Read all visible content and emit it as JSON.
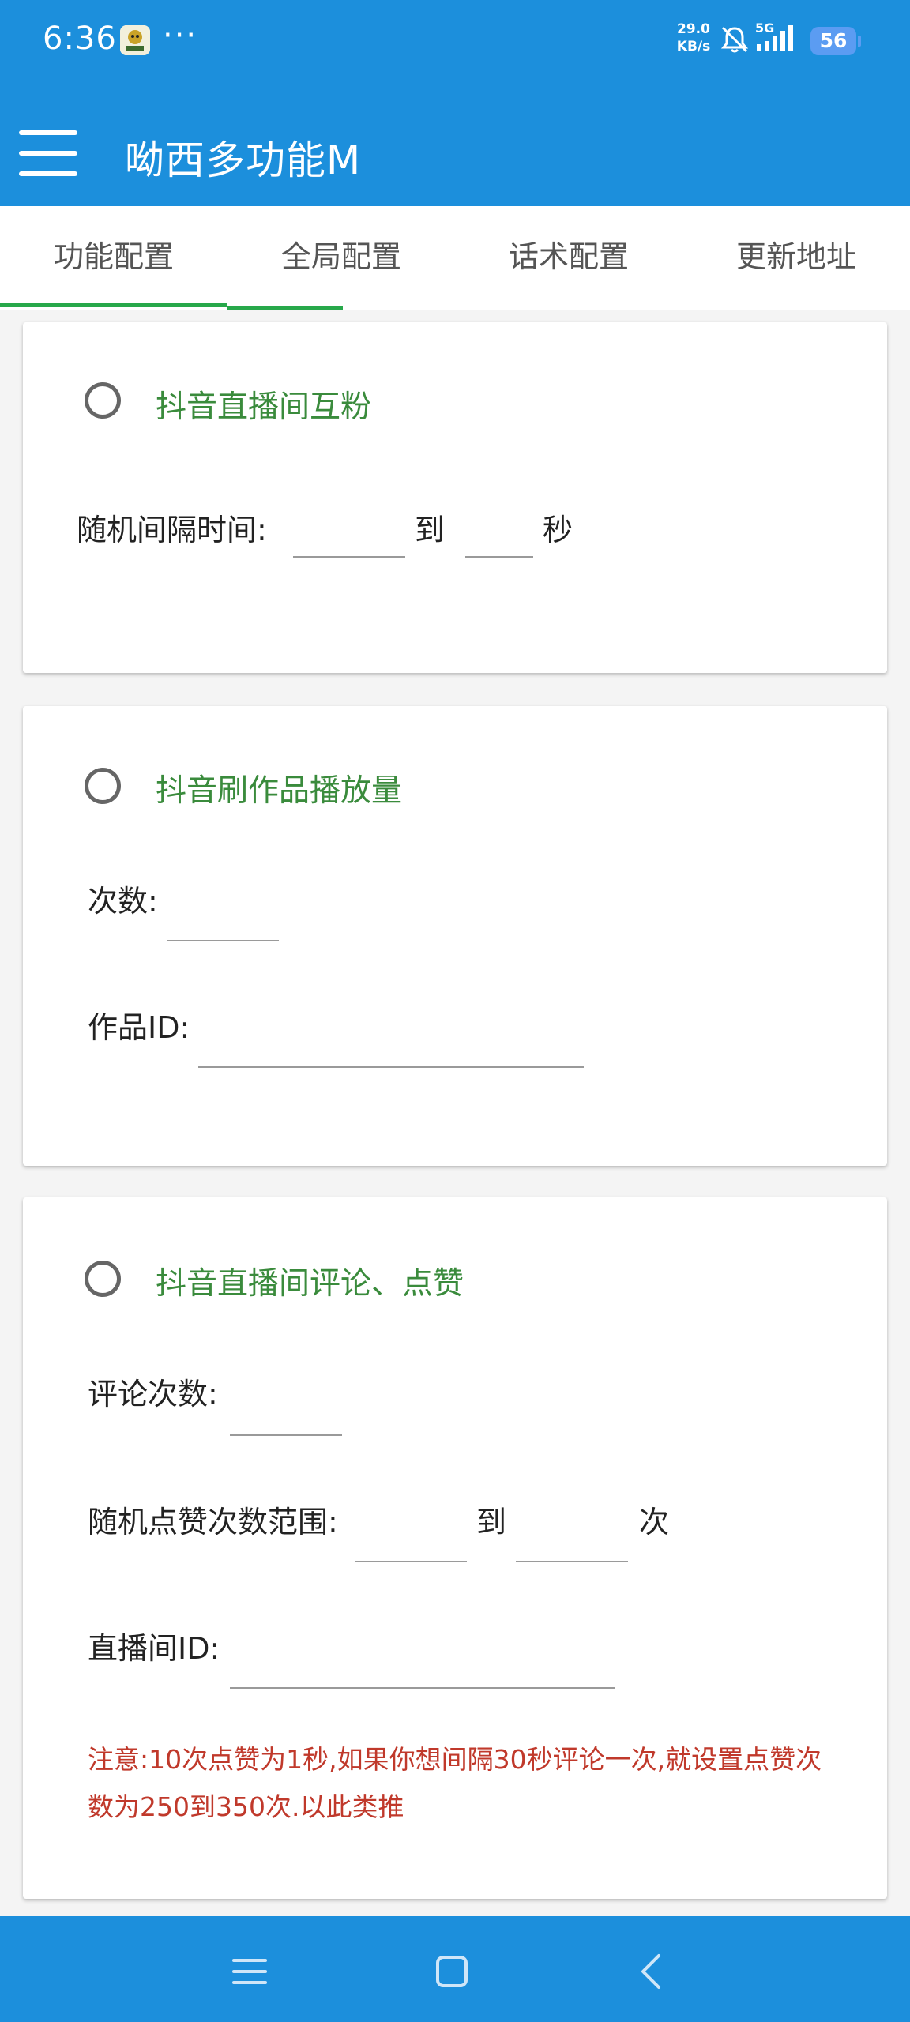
{
  "status_bar": {
    "time": "6:36",
    "dots": "···",
    "net_speed_value": "29.0",
    "net_speed_unit": "KB/s",
    "network_type": "5G",
    "battery_level": "56"
  },
  "app_bar": {
    "title": "呦西多功能M"
  },
  "tabs": [
    {
      "label": "功能配置"
    },
    {
      "label": "全局配置"
    },
    {
      "label": "话术配置"
    },
    {
      "label": "更新地址"
    }
  ],
  "cards": {
    "live_follow": {
      "title": "抖音直播间互粉",
      "interval_label": "随机间隔时间:",
      "to_label": "到",
      "unit_label": "秒"
    },
    "play_count": {
      "title": "抖音刷作品播放量",
      "count_label": "次数:",
      "work_id_label": "作品ID:"
    },
    "comment_like": {
      "title": "抖音直播间评论、点赞",
      "comment_count_label": "评论次数:",
      "like_range_label": "随机点赞次数范围:",
      "to_label": "到",
      "unit_label": "次",
      "room_id_label": "直播间ID:",
      "note": "注意:10次点赞为1秒,如果你想间隔30秒评论一次,就设置点赞次数为250到350次.以此类推"
    }
  },
  "colors": {
    "primary": "#1c8fdc",
    "tab_indicator": "#27a84a",
    "feature_title": "#3a8b3c",
    "note_text": "#c0392b"
  },
  "icons": {
    "menu": "hamburger-menu-icon",
    "mute": "bell-off-icon",
    "signal": "signal-bars-icon",
    "nav_recents": "recents-icon",
    "nav_home": "home-icon",
    "nav_back": "back-icon"
  }
}
